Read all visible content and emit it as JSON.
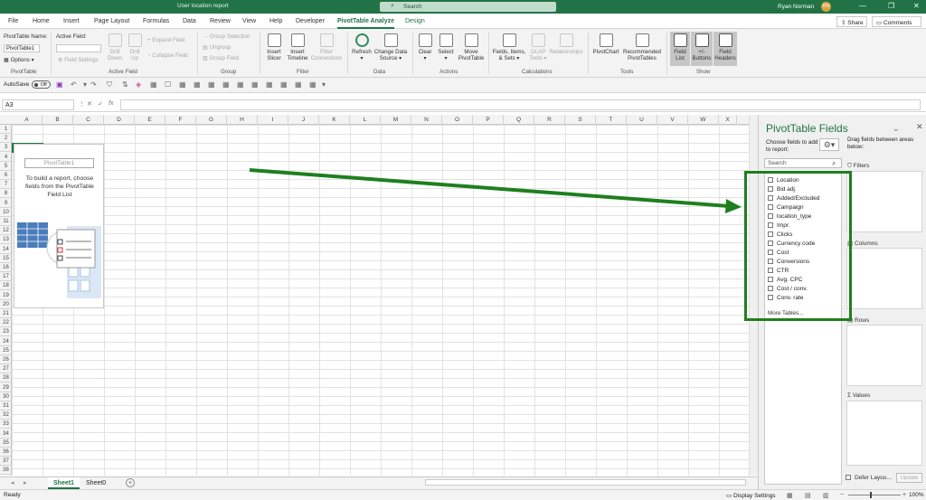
{
  "window": {
    "doc_title": "User location report",
    "search_placeholder": "Search",
    "user_name": "Ryan Norman",
    "user_initials": "RN",
    "controls": [
      "—",
      "❐",
      "✕"
    ]
  },
  "menu": {
    "tabs": [
      "File",
      "Home",
      "Insert",
      "Page Layout",
      "Formulas",
      "Data",
      "Review",
      "View",
      "Help",
      "Developer",
      "PivotTable Analyze",
      "Design"
    ],
    "share": "Share",
    "comments": "Comments"
  },
  "ribbon": {
    "pivot_name_label": "PivotTable Name:",
    "pivot_name_value": "PivotTable1",
    "options": "Options",
    "active_field_label": "Active Field:",
    "field_settings": "Field Settings",
    "drill_down": "Drill Down",
    "drill_up": "Drill Up",
    "expand_field": "Expand Field",
    "collapse_field": "Collapse Field",
    "group_selection": "Group Selection",
    "ungroup": "Ungroup",
    "group_field": "Group Field",
    "insert_slicer": "Insert Slicer",
    "insert_timeline": "Insert Timeline",
    "filter_connections": "Filter Connections",
    "refresh": "Refresh",
    "change_data_source": "Change Data Source",
    "clear": "Clear",
    "select": "Select",
    "move_pivottable": "Move PivotTable",
    "fields_items_sets": "Fields, Items, & Sets",
    "olap_tools": "OLAP Tools",
    "relationships": "Relationships",
    "pivotchart": "PivotChart",
    "recommended_pivottables": "Recommended PivotTables",
    "field_list": "Field List",
    "buttons": "+/- Buttons",
    "field_headers": "Field Headers",
    "groups": [
      "PivotTable",
      "Active Field",
      "Group",
      "Filter",
      "Data",
      "Actions",
      "Calculations",
      "Tools",
      "Show"
    ]
  },
  "qat": {
    "autosave": "AutoSave",
    "toggle": "Off"
  },
  "formula_bar": {
    "name_box": "A3",
    "fx": "fx"
  },
  "grid": {
    "columns": [
      "A",
      "B",
      "C",
      "D",
      "E",
      "F",
      "G",
      "H",
      "I",
      "J",
      "K",
      "L",
      "M",
      "N",
      "O",
      "P",
      "Q",
      "R",
      "S",
      "T",
      "U",
      "V",
      "W",
      "X"
    ],
    "rows": [
      "1",
      "2",
      "3",
      "4",
      "5",
      "6",
      "7",
      "8",
      "9",
      "10",
      "11",
      "12",
      "13",
      "14",
      "15",
      "16",
      "17",
      "18",
      "19",
      "20",
      "21",
      "22",
      "23",
      "24",
      "25",
      "26",
      "27",
      "28",
      "29",
      "30",
      "31",
      "32",
      "33",
      "34",
      "35",
      "36",
      "37",
      "38"
    ]
  },
  "placeholder": {
    "name": "PivotTable1",
    "text": "To build a report, choose fields from the PivotTable Field List"
  },
  "sheets": {
    "tabs": [
      "Sheet1",
      "Sheet0"
    ],
    "add": "+"
  },
  "status": {
    "ready": "Ready",
    "display_settings": "Display Settings",
    "zoom": "100%"
  },
  "pane": {
    "title": "PivotTable Fields",
    "choose": "Choose fields to add to report:",
    "drag": "Drag fields between areas below:",
    "search_placeholder": "Search",
    "fields": [
      "Location",
      "Bid adj.",
      "Added/Excluded",
      "Campaign",
      "location_type",
      "Impr.",
      "Clicks",
      "Currency code",
      "Cost",
      "Conversions",
      "CTR",
      "Avg. CPC",
      "Cost / conv.",
      "Conv. rate"
    ],
    "more_tables": "More Tables...",
    "areas": {
      "filters": "Filters",
      "columns": "Columns",
      "rows": "Rows",
      "values": "Values"
    },
    "defer": "Defer Layou...",
    "update": "Update"
  },
  "colors": {
    "excel_green": "#217346",
    "annotation_green": "#1e7f1e"
  }
}
